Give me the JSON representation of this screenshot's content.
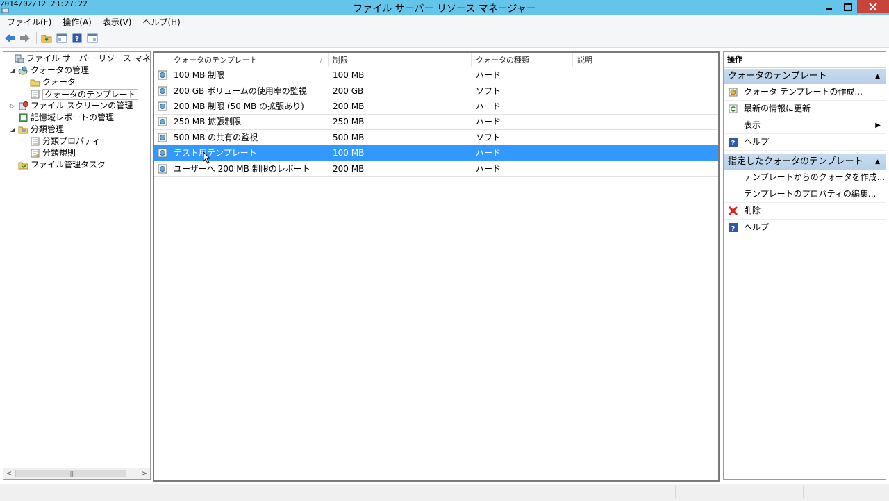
{
  "window": {
    "timestamp": "2014/02/12 23:27:22",
    "title": "ファイル サーバー リソース マネージャー"
  },
  "menu": [
    "ファイル(F)",
    "操作(A)",
    "表示(V)",
    "ヘルプ(H)"
  ],
  "tree": {
    "root": "ファイル サーバー リソース マネージャー (ロ-",
    "quota_mgmt": "クォータの管理",
    "quota": "クォータ",
    "quota_templates": "クォータのテンプレート",
    "file_screen": "ファイル スクリーンの管理",
    "storage_reports": "記憶域レポートの管理",
    "classification": "分類管理",
    "class_props": "分類プロパティ",
    "class_rules": "分類規則",
    "file_tasks": "ファイル管理タスク"
  },
  "list": {
    "columns": [
      "クォータのテンプレート",
      "制限",
      "クォータの種類",
      "説明"
    ],
    "rows": [
      {
        "name": "100 MB 制限",
        "limit": "100 MB",
        "type": "ハード",
        "desc": ""
      },
      {
        "name": "200 GB ボリュームの使用率の監視",
        "limit": "200 GB",
        "type": "ソフト",
        "desc": ""
      },
      {
        "name": "200 MB 制限 (50 MB の拡張あり)",
        "limit": "200 MB",
        "type": "ハード",
        "desc": ""
      },
      {
        "name": "250 MB 拡張制限",
        "limit": "250 MB",
        "type": "ハード",
        "desc": ""
      },
      {
        "name": "500 MB の共有の監視",
        "limit": "500 MB",
        "type": "ソフト",
        "desc": ""
      },
      {
        "name": "テスト用テンプレート",
        "limit": "100 MB",
        "type": "ハード",
        "desc": ""
      },
      {
        "name": "ユーザーへ 200 MB 制限のレポート",
        "limit": "200 MB",
        "type": "ハード",
        "desc": ""
      }
    ],
    "selected_index": 5
  },
  "actions": {
    "header": "操作",
    "section1": {
      "title": "クォータのテンプレート",
      "items": [
        "クォータ テンプレートの作成...",
        "最新の情報に更新",
        "表示",
        "ヘルプ"
      ]
    },
    "section2": {
      "title": "指定したクォータのテンプレート",
      "items": [
        "テンプレートからのクォータを作成...",
        "テンプレートのプロパティの編集...",
        "削除",
        "ヘルプ"
      ]
    }
  },
  "colors": {
    "titlebar": "#64c4ea",
    "selection": "#3399ff",
    "close_button": "#c8443b",
    "section_header": "#c8dcef"
  }
}
